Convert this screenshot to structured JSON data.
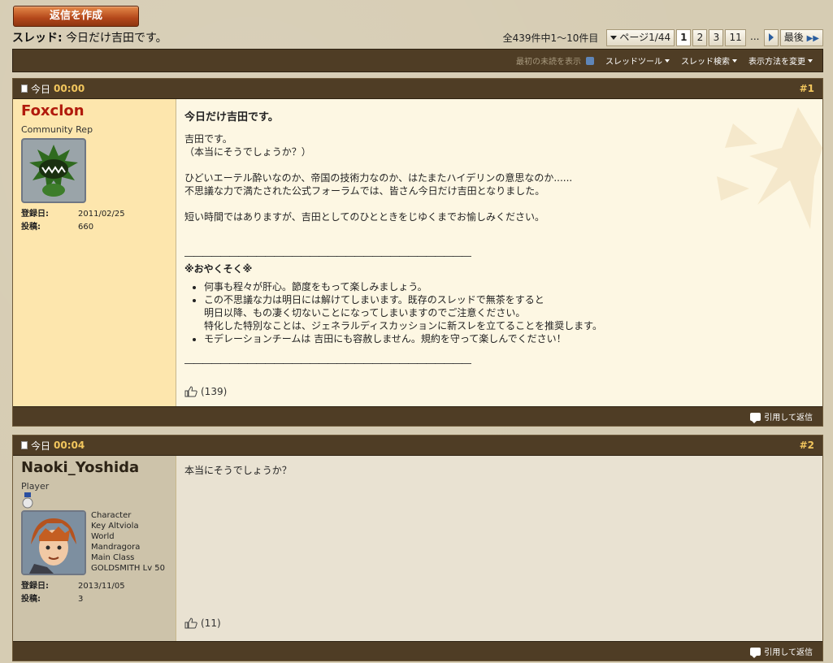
{
  "reply_button": "返信を作成",
  "thread": {
    "prefix": "スレッド:",
    "title": "今日だけ吉田です。"
  },
  "pager": {
    "count": "全439件中1～10件目",
    "page_label": "ページ1/44",
    "pages": [
      "1",
      "2",
      "3",
      "11"
    ],
    "ellipsis": "...",
    "last": "最後"
  },
  "toolbar": {
    "first_unread": "最初の未読を表示",
    "thread_tools": "スレッドツール",
    "thread_search": "スレッド検索",
    "display_mode": "表示方法を変更"
  },
  "posts": [
    {
      "date": "今日",
      "time": "00:00",
      "number": "#1",
      "username": "Foxclon",
      "usertitle": "Community Rep",
      "joined_label": "登録日:",
      "joined": "2011/02/25",
      "posts_label": "投稿:",
      "posts": "660",
      "title": "今日だけ吉田です。",
      "lines": [
        "吉田です。",
        "（本当にそうでしょうか？）",
        "ひどいエーテル酔いなのか、帝国の技術力なのか、はたまたハイデリンの意思なのか......",
        "不思議な力で満たされた公式フォーラムでは、皆さん今日だけ吉田となりました。",
        "短い時間ではありますが、吉田としてのひとときをじゆくまでお愉しみください。"
      ],
      "rule": "――――――――――――――――――――――――――――――――",
      "notice": "※おやくそく※",
      "bullets": [
        "何事も程々が肝心。節度をもって楽しみましょう。",
        "この不思議な力は明日には解けてしまいます。既存のスレッドで無茶をすると",
        "明日以降、もの凄く切ないことになってしまいますのでご注意ください。",
        "特化した特別なことは、ジェネラルディスカッションに新スレを立てることを推奨します。",
        "モデレーションチームは 吉田にも容赦しません。規約を守って楽しんでください！"
      ],
      "likes": "(139)",
      "quote": "引用して返信"
    },
    {
      "date": "今日",
      "time": "00:04",
      "number": "#2",
      "username": "Naoki_Yoshida",
      "usertitle": "Player",
      "char_lines": [
        "Character",
        "Key Altviola",
        "World",
        "Mandragora",
        "Main Class",
        "GOLDSMITH Lv 50"
      ],
      "joined_label": "登録日:",
      "joined": "2013/11/05",
      "posts_label": "投稿:",
      "posts": "3",
      "text": "本当にそうでしょうか？",
      "likes": "(11)",
      "quote": "引用して返信"
    }
  ],
  "colors": {
    "bar": "#4f3d25",
    "gold": "#f2c65d",
    "red_name": "#b11a0c"
  },
  "icons": [
    "doc-icon",
    "thumb-up-icon",
    "quote-icon",
    "arrow-right-icon",
    "double-arrow-icon",
    "dropdown-icon",
    "medal-icon"
  ]
}
